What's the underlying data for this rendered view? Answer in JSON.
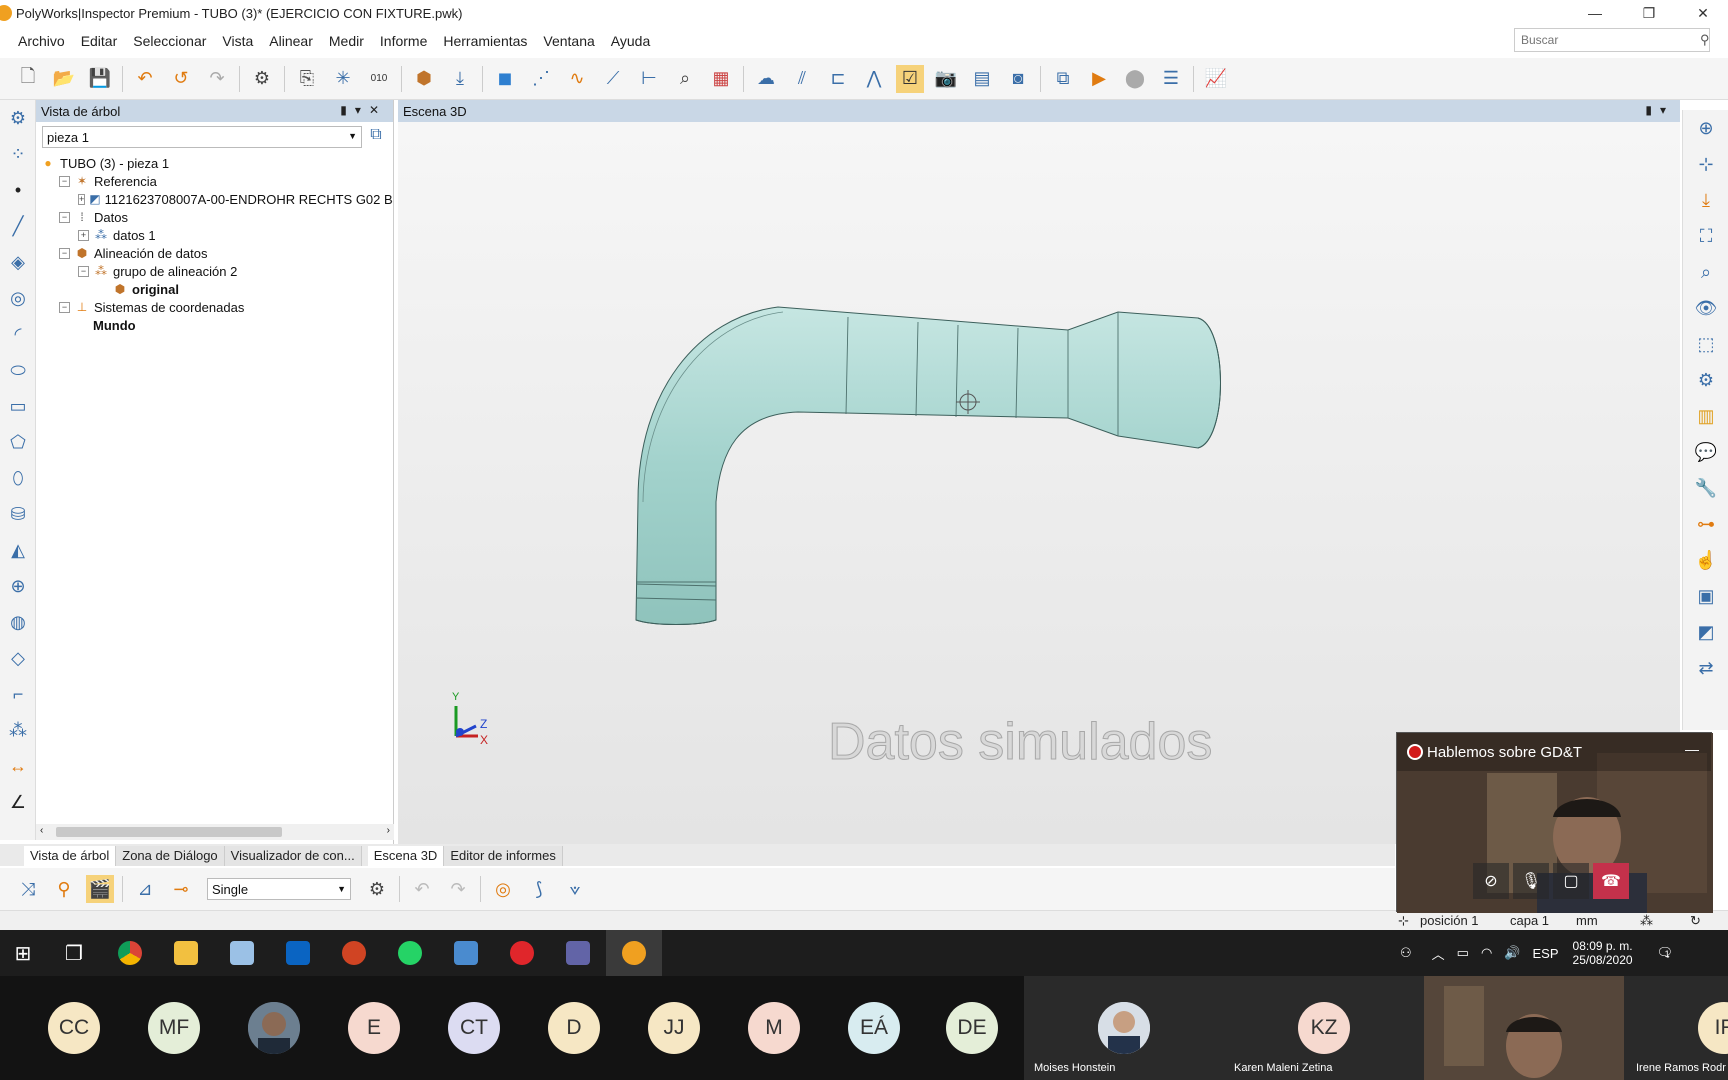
{
  "window": {
    "title": "PolyWorks|Inspector Premium - TUBO (3)* (EJERCICIO CON FIXTURE.pwk)",
    "minimize": "—",
    "maximize": "❐",
    "close": "✕"
  },
  "menu": [
    "Archivo",
    "Editar",
    "Seleccionar",
    "Vista",
    "Alinear",
    "Medir",
    "Informe",
    "Herramientas",
    "Ventana",
    "Ayuda"
  ],
  "search": {
    "placeholder": "Buscar"
  },
  "tree_panel": {
    "title": "Vista de árbol",
    "piece": "pieza 1",
    "items": [
      {
        "label": "TUBO (3) - pieza 1",
        "indent": 0,
        "toggle": "",
        "icon": "part-icon",
        "bold": false
      },
      {
        "label": "Referencia",
        "indent": 1,
        "toggle": "−",
        "icon": "reference-icon",
        "bold": false
      },
      {
        "label": "1121623708007A-00-ENDROHR RECHTS G02 B4",
        "indent": 2,
        "toggle": "+",
        "icon": "cad-model-icon",
        "bold": false
      },
      {
        "label": "Datos",
        "indent": 1,
        "toggle": "−",
        "icon": "data-icon",
        "bold": false
      },
      {
        "label": "datos 1",
        "indent": 2,
        "toggle": "+",
        "icon": "point-cloud-icon",
        "bold": false
      },
      {
        "label": "Alineación de datos",
        "indent": 1,
        "toggle": "−",
        "icon": "alignment-icon",
        "bold": false
      },
      {
        "label": "grupo de alineación 2",
        "indent": 2,
        "toggle": "−",
        "icon": "alignment-group-icon",
        "bold": false
      },
      {
        "label": "original",
        "indent": 3,
        "toggle": "",
        "icon": "alignment-icon",
        "bold": true
      },
      {
        "label": "Sistemas de coordenadas",
        "indent": 1,
        "toggle": "−",
        "icon": "coordinate-system-icon",
        "bold": false
      },
      {
        "label": "Mundo",
        "indent": 2,
        "toggle": "",
        "icon": "",
        "bold": true
      }
    ]
  },
  "scene": {
    "title": "Escena 3D",
    "watermark": "Datos simulados",
    "axes": {
      "y": "Y",
      "z": "Z",
      "x": "X"
    }
  },
  "bottom_tabs": [
    "Vista de árbol",
    "Zona de Diálogo",
    "Visualizador de con...",
    "Escena 3D",
    "Editor de informes"
  ],
  "bottom_toolbar": {
    "mode": "Single"
  },
  "status": {
    "position": "posición 1",
    "layer": "capa 1",
    "unit": "mm"
  },
  "taskbar": {
    "language": "ESP",
    "time": "08:09 p. m.",
    "date": "25/08/2020",
    "notifications": "1"
  },
  "call": {
    "meeting_title": "Hablemos sobre GD&T"
  },
  "participants": [
    {
      "initials": "CC",
      "color": "#f6e7c4"
    },
    {
      "initials": "MF",
      "color": "#e4eed8"
    },
    {
      "initials": "E",
      "color": "#f6d9cf"
    },
    {
      "initials": "CT",
      "color": "#dcdcf2"
    },
    {
      "initials": "D",
      "color": "#f6e7c4"
    },
    {
      "initials": "JJ",
      "color": "#f6e7c4"
    },
    {
      "initials": "M",
      "color": "#f6d9cf"
    },
    {
      "initials": "EÁ",
      "color": "#d8ecf0"
    },
    {
      "initials": "DE",
      "color": "#e4eed8"
    },
    {
      "initials": "KZ",
      "color": "#f6d9cf"
    },
    {
      "initials": "IF",
      "color": "#f6e7c4"
    }
  ],
  "named_participants": [
    "Moises Honstein",
    "Karen Maleni Zetina",
    "Irene Ramos Rodr"
  ]
}
